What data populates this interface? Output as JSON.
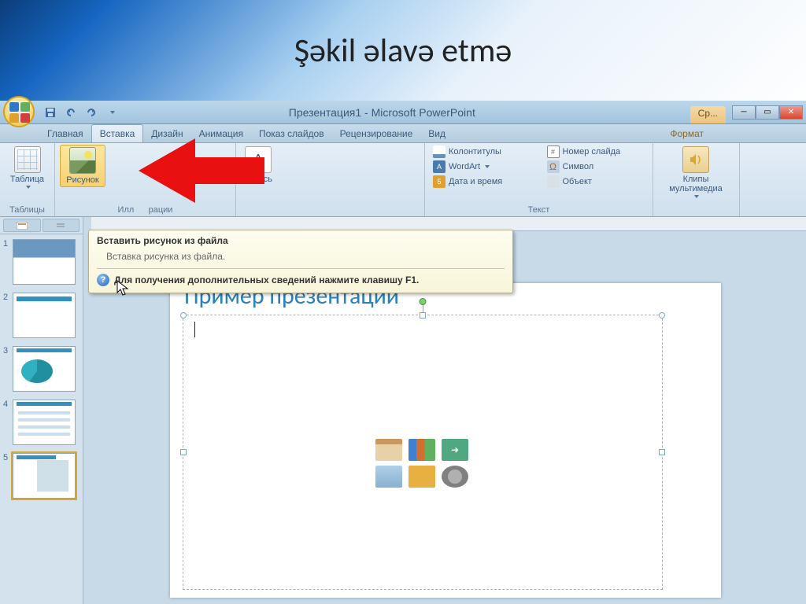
{
  "page": {
    "title": "Şəkil əlavə etmə"
  },
  "titlebar": {
    "text": "Презентация1 - Microsoft PowerPoint"
  },
  "contextual": {
    "label": "Ср..."
  },
  "tabs": {
    "home": "Главная",
    "insert": "Вставка",
    "design": "Дизайн",
    "animation": "Анимация",
    "slideshow": "Показ слайдов",
    "review": "Рецензирование",
    "view": "Вид",
    "format": "Формат"
  },
  "ribbon": {
    "tables": {
      "label": "Таблицы",
      "table": "Таблица"
    },
    "illustrations": {
      "label": "Иллюстрации",
      "picture": "Рисунок"
    },
    "links_partial": "адпись",
    "textbox_prefix": "A",
    "text": {
      "label": "Текст",
      "headerfooter": "Колонтитулы",
      "wordart": "WordArt",
      "datetime": "Дата и время",
      "slidenumber": "Номер слайда",
      "symbol": "Символ",
      "object": "Объект"
    },
    "media": {
      "label": "",
      "clips": "Клипы мультимедиа"
    }
  },
  "tooltip": {
    "title": "Вставить рисунок из файла",
    "desc": "Вставка рисунка из файла.",
    "help": "Для получения дополнительных сведений нажмите клавишу F1."
  },
  "slide": {
    "title": "Пример презентации"
  },
  "thumbs": [
    "1",
    "2",
    "3",
    "4",
    "5"
  ]
}
